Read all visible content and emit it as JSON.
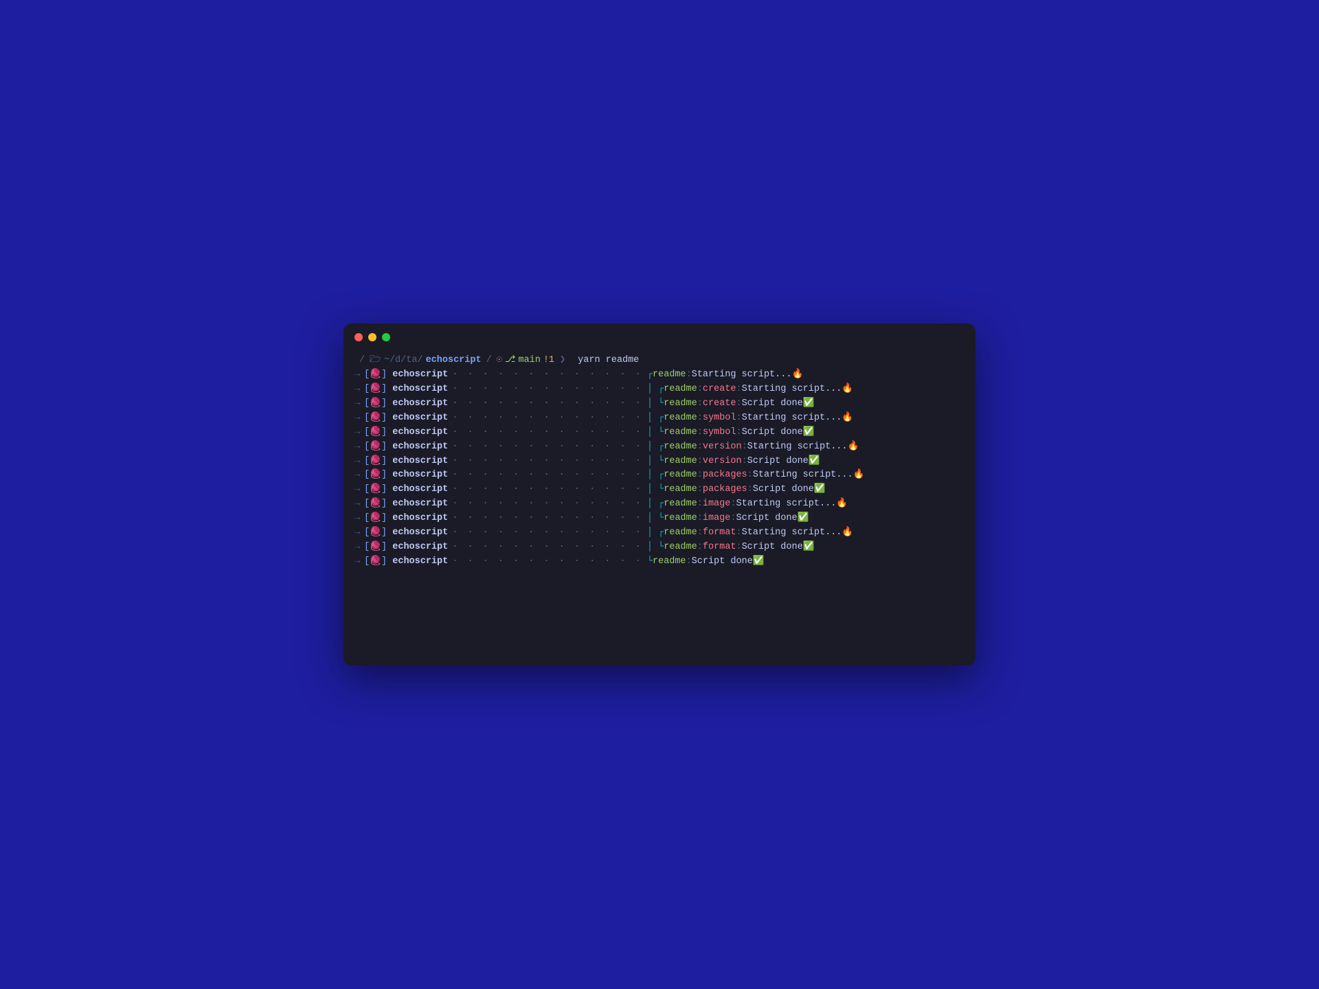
{
  "prompt": {
    "apple": "",
    "folder": "📁",
    "path_prefix": "~/d/ta/",
    "path_current": "echoscript",
    "github": "🐙",
    "branch_icon": "⎇",
    "branch": "main",
    "bang": "!1",
    "chevron": "❯",
    "command": "yarn readme"
  },
  "scope_label": "echoscript",
  "yarn_glyph": "🧶",
  "dots": "· · · · · · · · · · · · ·",
  "lines": [
    {
      "tree": "┌",
      "readme": "readme",
      "sub": "",
      "msg": "Starting script...",
      "emoji": "🔥"
    },
    {
      "tree": "│ ┌",
      "readme": "readme",
      "sub": "create",
      "msg": "Starting script...",
      "emoji": "🔥"
    },
    {
      "tree": "│ └",
      "readme": "readme",
      "sub": "create",
      "msg": "Script done",
      "emoji": "✅"
    },
    {
      "tree": "│ ┌",
      "readme": "readme",
      "sub": "symbol",
      "msg": "Starting script...",
      "emoji": "🔥"
    },
    {
      "tree": "│ └",
      "readme": "readme",
      "sub": "symbol",
      "msg": "Script done",
      "emoji": "✅"
    },
    {
      "tree": "│ ┌",
      "readme": "readme",
      "sub": "version",
      "msg": "Starting script...",
      "emoji": "🔥"
    },
    {
      "tree": "│ └",
      "readme": "readme",
      "sub": "version",
      "msg": "Script done",
      "emoji": "✅"
    },
    {
      "tree": "│ ┌",
      "readme": "readme",
      "sub": "packages",
      "msg": "Starting script...",
      "emoji": "🔥"
    },
    {
      "tree": "│ └",
      "readme": "readme",
      "sub": "packages",
      "msg": "Script done",
      "emoji": "✅"
    },
    {
      "tree": "│ ┌",
      "readme": "readme",
      "sub": "image",
      "msg": "Starting script...",
      "emoji": "🔥"
    },
    {
      "tree": "│ └",
      "readme": "readme",
      "sub": "image",
      "msg": "Script done",
      "emoji": "✅"
    },
    {
      "tree": "│ ┌",
      "readme": "readme",
      "sub": "format",
      "msg": "Starting script...",
      "emoji": "🔥"
    },
    {
      "tree": "│ └",
      "readme": "readme",
      "sub": "format",
      "msg": "Script done",
      "emoji": "✅"
    },
    {
      "tree": "└",
      "readme": "readme",
      "sub": "",
      "msg": "Script done",
      "emoji": "✅"
    }
  ]
}
